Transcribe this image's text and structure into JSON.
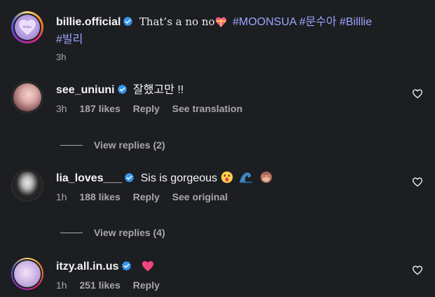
{
  "caption": {
    "username": "billie.official",
    "text": "That’s a no no",
    "hashtags": [
      "#MOONSUA",
      "#문수아",
      "#Billlie",
      "#빌리"
    ],
    "time": "3h",
    "avatar_text": "Billlie"
  },
  "comments": [
    {
      "username": "see_uniuni",
      "text": "잘했고만 !!",
      "time": "3h",
      "likes": "187 likes",
      "reply": "Reply",
      "extra": "See translation",
      "view_replies": "View replies (2)"
    },
    {
      "username": "lia_loves___",
      "text": "Sis is gorgeous",
      "emojis": [
        "astonished-face",
        "water-wave",
        "see-no-evil-monkey"
      ],
      "time": "1h",
      "likes": "188 likes",
      "reply": "Reply",
      "extra": "See original",
      "view_replies": "View replies (4)"
    },
    {
      "username": "itzy.all.in.us",
      "text": "",
      "emojis": [
        "pink-heart"
      ],
      "time": "1h",
      "likes": "251 likes",
      "reply": "Reply"
    }
  ],
  "colors": {
    "background": "#1c1e21",
    "hashtag": "#9da7ff",
    "verified": "#3797f0",
    "secondary_text": "#a8a8a8"
  }
}
